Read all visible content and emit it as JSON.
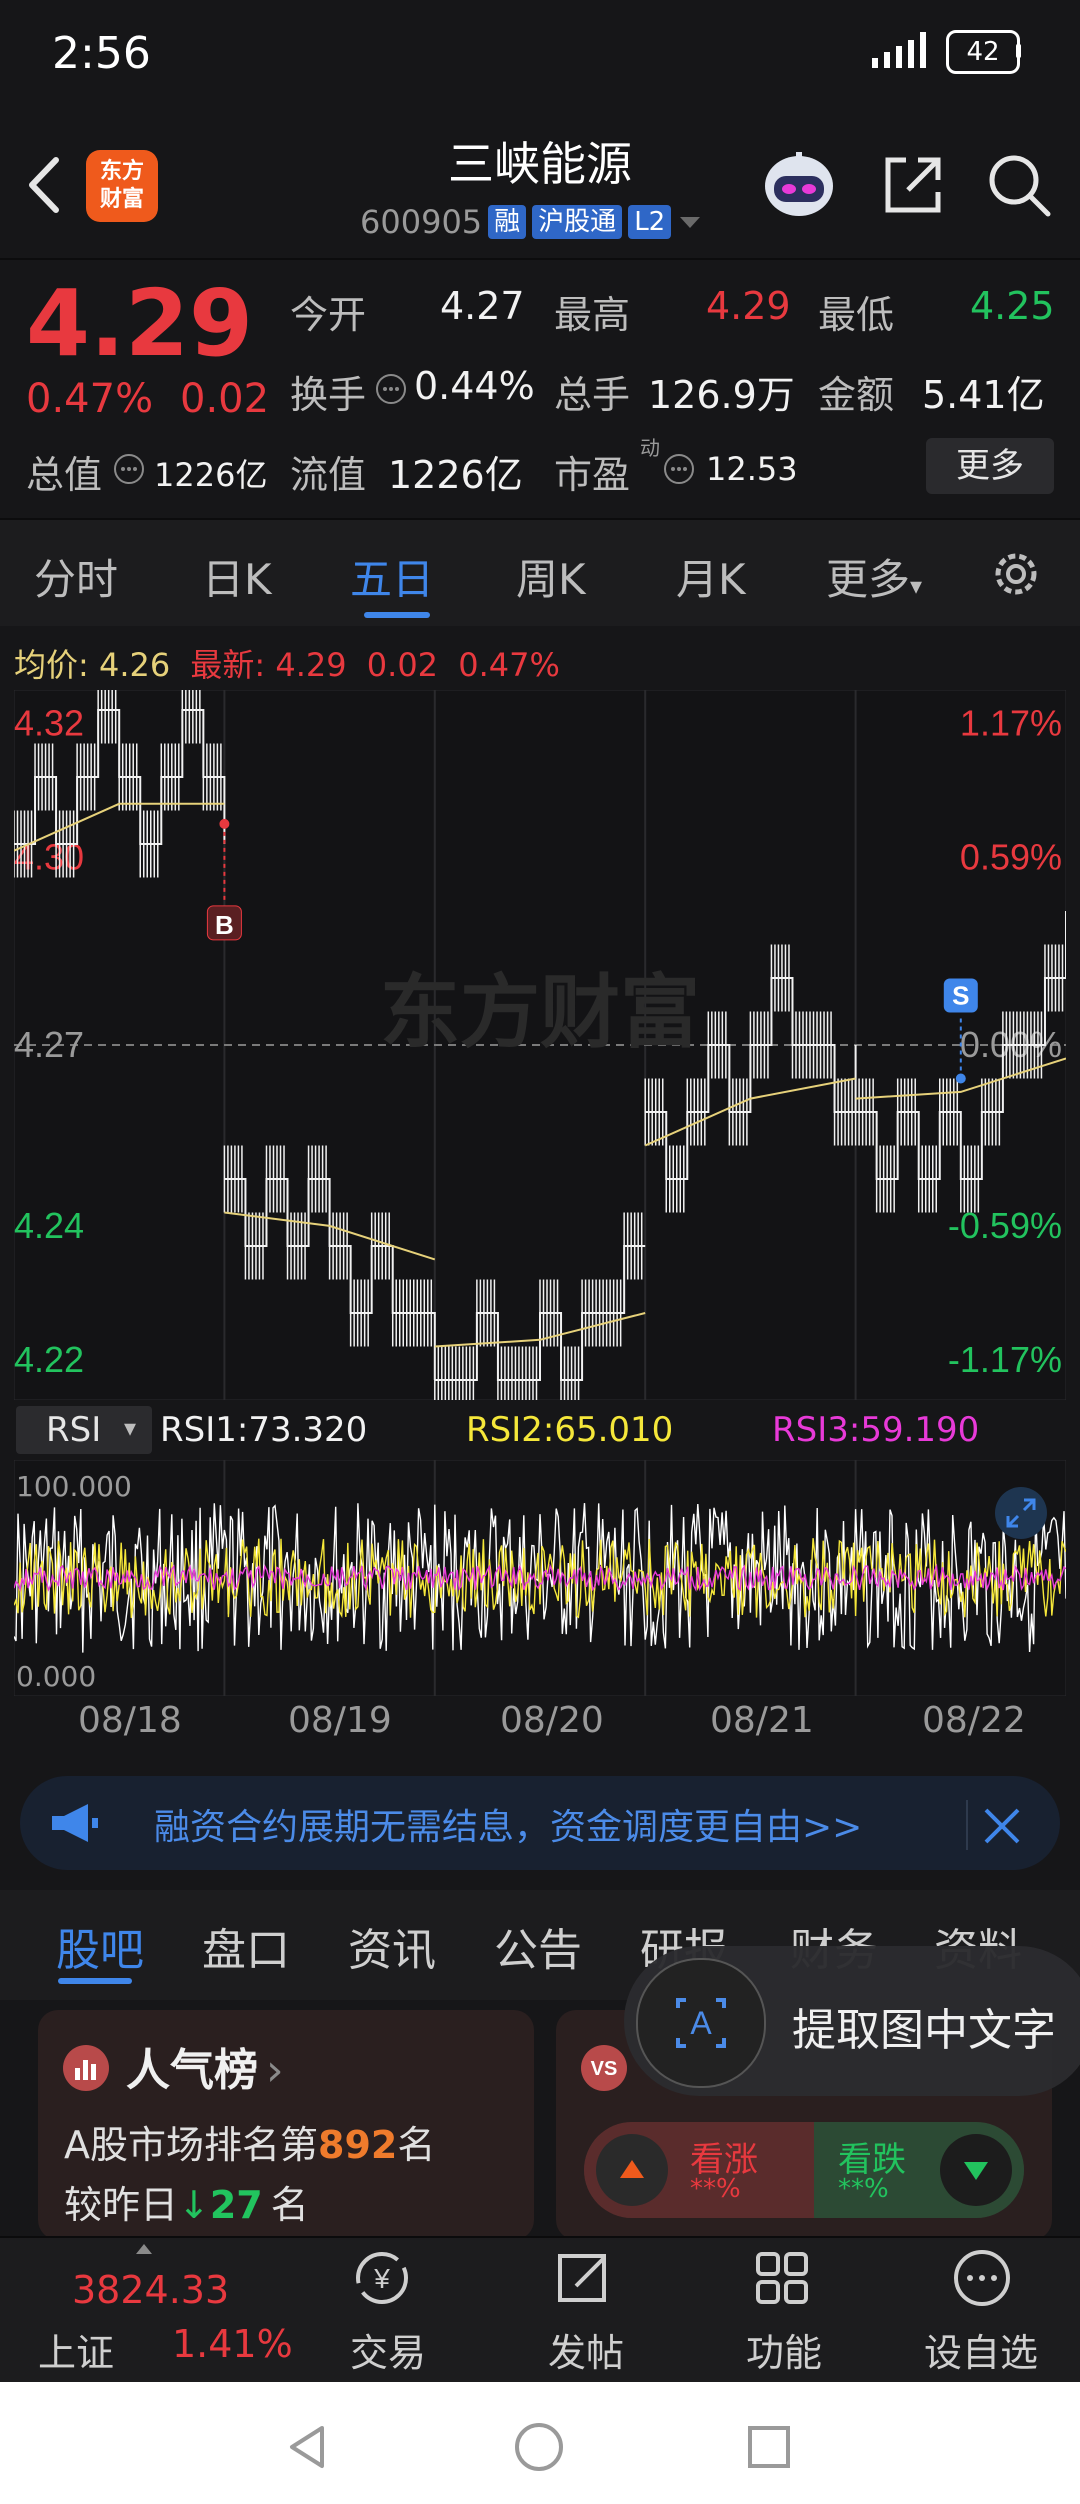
{
  "status_bar": {
    "time": "2:56",
    "battery": "42"
  },
  "header": {
    "logo": "东方财富",
    "stock_name": "三峡能源",
    "stock_code": "600905",
    "tags": [
      "融",
      "沪股通",
      "L2"
    ]
  },
  "quote": {
    "price": "4.29",
    "change_pct": "0.47%",
    "change": "0.02",
    "open_label": "今开",
    "open": "4.27",
    "high_label": "最高",
    "high": "4.29",
    "low_label": "最低",
    "low": "4.25",
    "turnover_label": "换手",
    "turnover": "0.44%",
    "volume_label": "总手",
    "volume": "126.9万",
    "amount_label": "金额",
    "amount": "5.41亿",
    "mktcap_label": "总值",
    "mktcap": "1226亿",
    "float_label": "流值",
    "float": "1226亿",
    "pe_label": "市盈",
    "pe_sup": "动",
    "pe": "12.53",
    "more_button": "更多"
  },
  "chart_tabs": [
    "分时",
    "日K",
    "五日",
    "周K",
    "月K",
    "更多"
  ],
  "chart_tabs_active": 2,
  "avg_row": {
    "avg_label": "均价:",
    "avg": "4.26",
    "latest_label": "最新:",
    "latest": "4.29",
    "change": "0.02",
    "change_pct": "0.47%"
  },
  "chart_data": {
    "type": "line",
    "title": "",
    "y_left_ticks": [
      "4.32",
      "4.30",
      "4.27",
      "4.24",
      "4.22"
    ],
    "y_right_ticks": [
      "1.17%",
      "0.59%",
      "0.00%",
      "-0.59%",
      "-1.17%"
    ],
    "ylim": [
      4.22,
      4.32
    ],
    "reference_price": 4.27,
    "x_days": [
      "08/18",
      "08/19",
      "08/20",
      "08/21",
      "08/22"
    ],
    "price_segments": [
      {
        "x": [
          0.0,
          0.1,
          0.2,
          0.3,
          0.4,
          0.5,
          0.6,
          0.7,
          0.8,
          0.9,
          1.0
        ],
        "y": [
          4.3,
          4.31,
          4.3,
          4.31,
          4.32,
          4.31,
          4.3,
          4.31,
          4.32,
          4.31,
          4.3
        ]
      },
      {
        "x": [
          1.0,
          1.1,
          1.2,
          1.3,
          1.4,
          1.5,
          1.6,
          1.7,
          1.8,
          1.9,
          2.0
        ],
        "y": [
          4.25,
          4.24,
          4.25,
          4.24,
          4.25,
          4.24,
          4.23,
          4.24,
          4.23,
          4.23,
          4.22
        ]
      },
      {
        "x": [
          2.0,
          2.1,
          2.2,
          2.3,
          2.4,
          2.5,
          2.6,
          2.7,
          2.8,
          2.9,
          3.0
        ],
        "y": [
          4.22,
          4.22,
          4.23,
          4.22,
          4.22,
          4.23,
          4.22,
          4.23,
          4.23,
          4.24,
          4.24
        ]
      },
      {
        "x": [
          3.0,
          3.1,
          3.2,
          3.3,
          3.4,
          3.5,
          3.6,
          3.7,
          3.8,
          3.9,
          4.0
        ],
        "y": [
          4.26,
          4.25,
          4.26,
          4.27,
          4.26,
          4.27,
          4.28,
          4.27,
          4.27,
          4.26,
          4.27
        ]
      },
      {
        "x": [
          4.0,
          4.1,
          4.2,
          4.3,
          4.4,
          4.5,
          4.6,
          4.7,
          4.8,
          4.9,
          5.0
        ],
        "y": [
          4.26,
          4.25,
          4.26,
          4.25,
          4.26,
          4.25,
          4.26,
          4.27,
          4.27,
          4.28,
          4.29
        ]
      }
    ],
    "avg_segments": [
      {
        "x": [
          0.0,
          0.5,
          1.0
        ],
        "y": [
          4.299,
          4.306,
          4.306
        ]
      },
      {
        "x": [
          1.0,
          1.5,
          2.0
        ],
        "y": [
          4.245,
          4.243,
          4.238
        ]
      },
      {
        "x": [
          2.0,
          2.5,
          3.0
        ],
        "y": [
          4.225,
          4.226,
          4.23
        ]
      },
      {
        "x": [
          3.0,
          3.5,
          4.0
        ],
        "y": [
          4.255,
          4.262,
          4.265
        ]
      },
      {
        "x": [
          4.0,
          4.5,
          5.0
        ],
        "y": [
          4.262,
          4.263,
          4.268
        ]
      }
    ],
    "markers": [
      {
        "label": "B",
        "x": 1.0,
        "y": 4.303,
        "color": "#e8393f"
      },
      {
        "label": "S",
        "x": 4.5,
        "y": 4.265,
        "color": "#3f86ea"
      }
    ],
    "grid": true
  },
  "rsi": {
    "selector": "RSI",
    "rsi1": "RSI1:73.320",
    "rsi2": "RSI2:65.010",
    "rsi3": "RSI3:59.190",
    "top_tick": "100.000",
    "bottom_tick": "0.000",
    "colors": {
      "rsi1": "#ffffff",
      "rsi2": "#f5e73a",
      "rsi3": "#e83ad8"
    }
  },
  "banner": {
    "text": "融资合约展期无需结息，资金调度更自由>>"
  },
  "section_tabs": [
    "股吧",
    "盘口",
    "资讯",
    "公告",
    "研报",
    "财务",
    "资料"
  ],
  "section_tabs_active": 0,
  "hot_card": {
    "title": "人气榜",
    "line1_prefix": "A股市场排名第",
    "rank": "892",
    "line1_suffix": "名",
    "line2_prefix": "较昨日",
    "rank_change": "27",
    "line2_suffix": "名"
  },
  "vote_card": {
    "up_label": "看涨",
    "up_value": "**%",
    "down_label": "看跌",
    "down_value": "**%"
  },
  "ocr_popup": {
    "text": "提取图中文字"
  },
  "toolbar": {
    "index_value": "3824.33",
    "index_name": "上证",
    "index_pct": "1.41%",
    "trade": "交易",
    "post": "发帖",
    "func": "功能",
    "watch": "设自选"
  },
  "colors": {
    "up": "#e8393f",
    "down": "#22c35e",
    "accent": "#3f86ea",
    "avg_line": "#e6d17a",
    "background": "#161618"
  }
}
